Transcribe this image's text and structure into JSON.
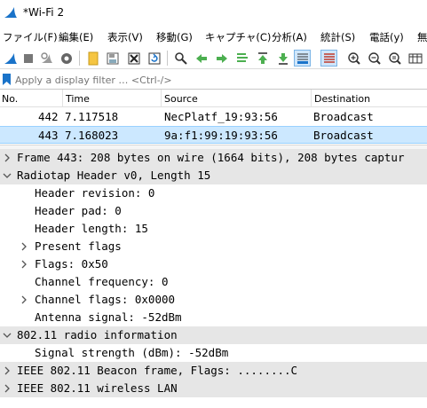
{
  "window": {
    "title": "*Wi-Fi 2"
  },
  "menu": [
    {
      "label": "ファイル(F)"
    },
    {
      "label": "編集(E)"
    },
    {
      "label": "表示(V)"
    },
    {
      "label": "移動(G)"
    },
    {
      "label": "キャプチャ(C)"
    },
    {
      "label": "分析(A)"
    },
    {
      "label": "統計(S)"
    },
    {
      "label": "電話(y)"
    },
    {
      "label": "無"
    }
  ],
  "filter": {
    "placeholder": "Apply a display filter … <Ctrl-/>"
  },
  "packet_list": {
    "columns": [
      "No.",
      "Time",
      "Source",
      "Destination"
    ],
    "rows": [
      {
        "no": "442",
        "time": "7.117518",
        "source": "NecPlatf_19:93:56",
        "destination": "Broadcast",
        "selected": false
      },
      {
        "no": "443",
        "time": "7.168023",
        "source": "9a:f1:99:19:93:56",
        "destination": "Broadcast",
        "selected": true
      }
    ]
  },
  "details": {
    "rows": [
      {
        "text": "Frame 443: 208 bytes on wire (1664 bits), 208 bytes captur",
        "state": "collapsed"
      },
      {
        "text": "Radiotap Header v0, Length 15",
        "state": "expanded"
      },
      {
        "text": "Header revision: 0",
        "state": "leaf"
      },
      {
        "text": "Header pad: 0",
        "state": "leaf"
      },
      {
        "text": "Header length: 15",
        "state": "leaf"
      },
      {
        "text": "Present flags",
        "state": "collapsed"
      },
      {
        "text": "Flags: 0x50",
        "state": "collapsed"
      },
      {
        "text": "Channel frequency: 0",
        "state": "leaf"
      },
      {
        "text": "Channel flags: 0x0000",
        "state": "collapsed"
      },
      {
        "text": "Antenna signal: -52dBm",
        "state": "leaf"
      },
      {
        "text": "802.11 radio information",
        "state": "expanded"
      },
      {
        "text": "Signal strength (dBm): -52dBm",
        "state": "leaf"
      },
      {
        "text": "IEEE 802.11 Beacon frame, Flags: ........C",
        "state": "collapsed"
      },
      {
        "text": "IEEE 802.11 wireless LAN",
        "state": "collapsed"
      }
    ]
  },
  "colors": {
    "selected_row": "#cce8ff",
    "highlight_row": "#e6e6e6",
    "accent_blue": "#1a73c9"
  },
  "icons": [
    "shark-fin-icon",
    "start-capture-icon",
    "stop-capture-icon",
    "restart-capture-icon",
    "capture-options-icon",
    "open-file-icon",
    "save-file-icon",
    "close-file-icon",
    "reload-file-icon",
    "find-packet-icon",
    "go-back-icon",
    "go-forward-icon",
    "go-to-packet-icon",
    "first-packet-icon",
    "last-packet-icon",
    "auto-scroll-icon",
    "colorize-icon",
    "zoom-in-icon",
    "zoom-out-icon",
    "normal-size-icon",
    "resize-columns-icon",
    "bookmark-icon"
  ]
}
